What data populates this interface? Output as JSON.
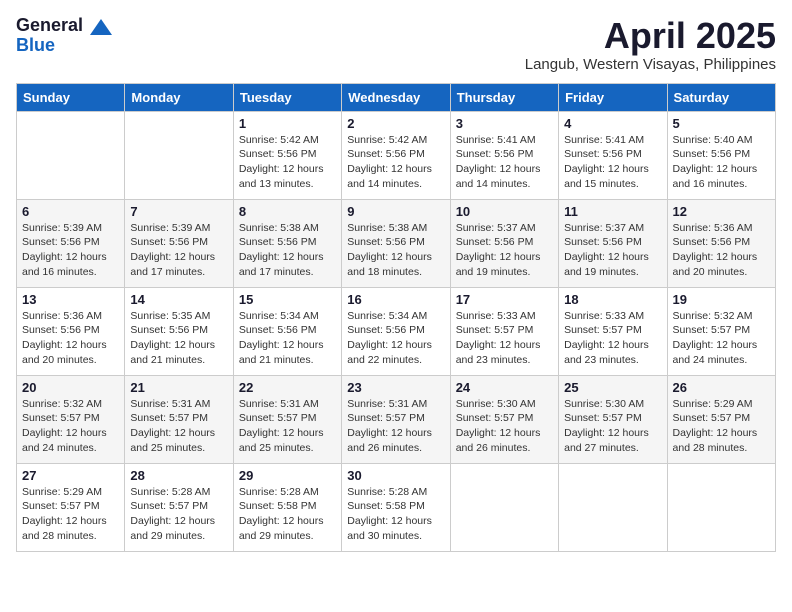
{
  "logo": {
    "general": "General",
    "blue": "Blue"
  },
  "header": {
    "title": "April 2025",
    "subtitle": "Langub, Western Visayas, Philippines"
  },
  "weekdays": [
    "Sunday",
    "Monday",
    "Tuesday",
    "Wednesday",
    "Thursday",
    "Friday",
    "Saturday"
  ],
  "weeks": [
    [
      {
        "day": "",
        "detail": ""
      },
      {
        "day": "",
        "detail": ""
      },
      {
        "day": "1",
        "detail": "Sunrise: 5:42 AM\nSunset: 5:56 PM\nDaylight: 12 hours\nand 13 minutes."
      },
      {
        "day": "2",
        "detail": "Sunrise: 5:42 AM\nSunset: 5:56 PM\nDaylight: 12 hours\nand 14 minutes."
      },
      {
        "day": "3",
        "detail": "Sunrise: 5:41 AM\nSunset: 5:56 PM\nDaylight: 12 hours\nand 14 minutes."
      },
      {
        "day": "4",
        "detail": "Sunrise: 5:41 AM\nSunset: 5:56 PM\nDaylight: 12 hours\nand 15 minutes."
      },
      {
        "day": "5",
        "detail": "Sunrise: 5:40 AM\nSunset: 5:56 PM\nDaylight: 12 hours\nand 16 minutes."
      }
    ],
    [
      {
        "day": "6",
        "detail": "Sunrise: 5:39 AM\nSunset: 5:56 PM\nDaylight: 12 hours\nand 16 minutes."
      },
      {
        "day": "7",
        "detail": "Sunrise: 5:39 AM\nSunset: 5:56 PM\nDaylight: 12 hours\nand 17 minutes."
      },
      {
        "day": "8",
        "detail": "Sunrise: 5:38 AM\nSunset: 5:56 PM\nDaylight: 12 hours\nand 17 minutes."
      },
      {
        "day": "9",
        "detail": "Sunrise: 5:38 AM\nSunset: 5:56 PM\nDaylight: 12 hours\nand 18 minutes."
      },
      {
        "day": "10",
        "detail": "Sunrise: 5:37 AM\nSunset: 5:56 PM\nDaylight: 12 hours\nand 19 minutes."
      },
      {
        "day": "11",
        "detail": "Sunrise: 5:37 AM\nSunset: 5:56 PM\nDaylight: 12 hours\nand 19 minutes."
      },
      {
        "day": "12",
        "detail": "Sunrise: 5:36 AM\nSunset: 5:56 PM\nDaylight: 12 hours\nand 20 minutes."
      }
    ],
    [
      {
        "day": "13",
        "detail": "Sunrise: 5:36 AM\nSunset: 5:56 PM\nDaylight: 12 hours\nand 20 minutes."
      },
      {
        "day": "14",
        "detail": "Sunrise: 5:35 AM\nSunset: 5:56 PM\nDaylight: 12 hours\nand 21 minutes."
      },
      {
        "day": "15",
        "detail": "Sunrise: 5:34 AM\nSunset: 5:56 PM\nDaylight: 12 hours\nand 21 minutes."
      },
      {
        "day": "16",
        "detail": "Sunrise: 5:34 AM\nSunset: 5:56 PM\nDaylight: 12 hours\nand 22 minutes."
      },
      {
        "day": "17",
        "detail": "Sunrise: 5:33 AM\nSunset: 5:57 PM\nDaylight: 12 hours\nand 23 minutes."
      },
      {
        "day": "18",
        "detail": "Sunrise: 5:33 AM\nSunset: 5:57 PM\nDaylight: 12 hours\nand 23 minutes."
      },
      {
        "day": "19",
        "detail": "Sunrise: 5:32 AM\nSunset: 5:57 PM\nDaylight: 12 hours\nand 24 minutes."
      }
    ],
    [
      {
        "day": "20",
        "detail": "Sunrise: 5:32 AM\nSunset: 5:57 PM\nDaylight: 12 hours\nand 24 minutes."
      },
      {
        "day": "21",
        "detail": "Sunrise: 5:31 AM\nSunset: 5:57 PM\nDaylight: 12 hours\nand 25 minutes."
      },
      {
        "day": "22",
        "detail": "Sunrise: 5:31 AM\nSunset: 5:57 PM\nDaylight: 12 hours\nand 25 minutes."
      },
      {
        "day": "23",
        "detail": "Sunrise: 5:31 AM\nSunset: 5:57 PM\nDaylight: 12 hours\nand 26 minutes."
      },
      {
        "day": "24",
        "detail": "Sunrise: 5:30 AM\nSunset: 5:57 PM\nDaylight: 12 hours\nand 26 minutes."
      },
      {
        "day": "25",
        "detail": "Sunrise: 5:30 AM\nSunset: 5:57 PM\nDaylight: 12 hours\nand 27 minutes."
      },
      {
        "day": "26",
        "detail": "Sunrise: 5:29 AM\nSunset: 5:57 PM\nDaylight: 12 hours\nand 28 minutes."
      }
    ],
    [
      {
        "day": "27",
        "detail": "Sunrise: 5:29 AM\nSunset: 5:57 PM\nDaylight: 12 hours\nand 28 minutes."
      },
      {
        "day": "28",
        "detail": "Sunrise: 5:28 AM\nSunset: 5:57 PM\nDaylight: 12 hours\nand 29 minutes."
      },
      {
        "day": "29",
        "detail": "Sunrise: 5:28 AM\nSunset: 5:58 PM\nDaylight: 12 hours\nand 29 minutes."
      },
      {
        "day": "30",
        "detail": "Sunrise: 5:28 AM\nSunset: 5:58 PM\nDaylight: 12 hours\nand 30 minutes."
      },
      {
        "day": "",
        "detail": ""
      },
      {
        "day": "",
        "detail": ""
      },
      {
        "day": "",
        "detail": ""
      }
    ]
  ]
}
